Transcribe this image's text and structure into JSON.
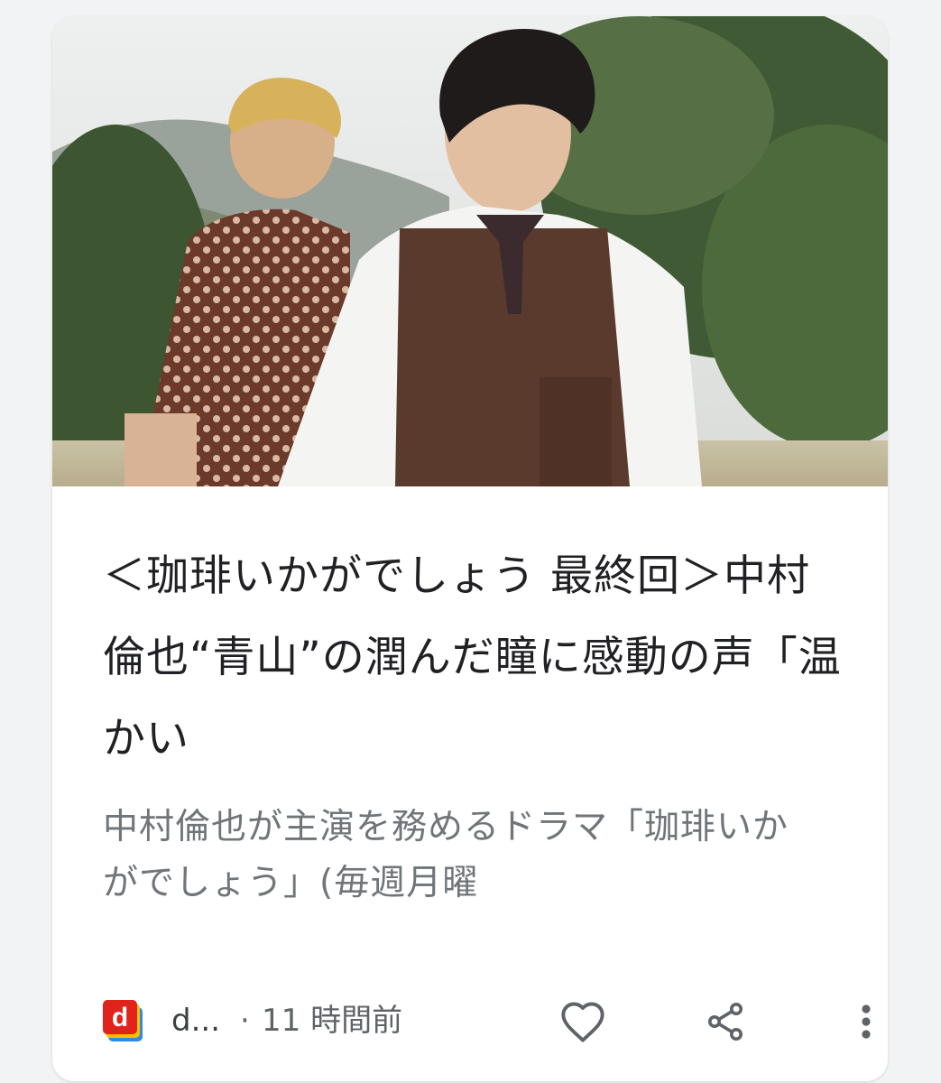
{
  "card": {
    "image_alt": "",
    "headline": "＜珈琲いかがでしょう 最終回＞中村倫也“青山”の潤んだ瞳に感動の声「温かい",
    "snippet": "中村倫也が主演を務めるドラマ「珈琲いかがでしょう」(毎週月曜",
    "source": {
      "logo_letter": "d",
      "name": "d...",
      "separator": "·",
      "time": "11 時間前"
    },
    "actions": {
      "like_icon": "heart-outline-icon",
      "share_icon": "share-icon",
      "more_icon": "more-vert-icon"
    },
    "colors": {
      "logo_red": "#e0241b",
      "logo_yellow": "#f6c200",
      "logo_blue": "#2f8ce0",
      "headline": "#202124",
      "snippet": "#70757a",
      "icon": "#5f6368"
    }
  }
}
